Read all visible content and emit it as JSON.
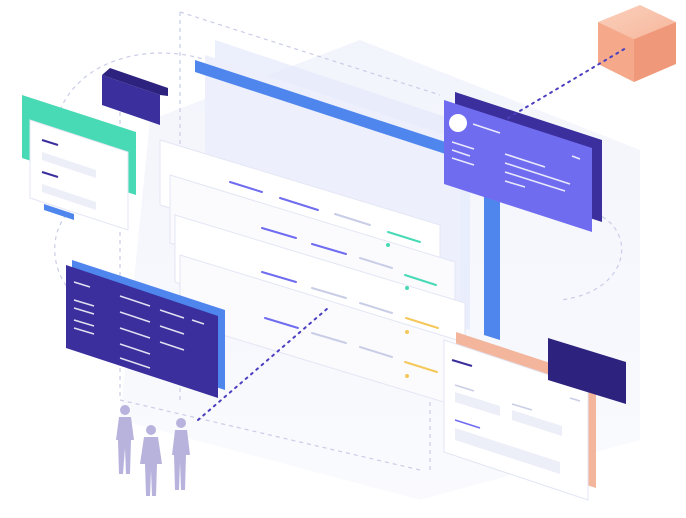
{
  "illustration": {
    "kind": "isometric dashboard illustration",
    "colors": {
      "indigo": "#3a2f9c",
      "indigo_dark": "#2d237f",
      "violet": "#6f6cf0",
      "blue": "#4f86ee",
      "mint": "#48d9b5",
      "peach": "#f3b59b",
      "cube": "#f5a98a",
      "figure": "#b8b3dd",
      "panel": "#f6f7fb",
      "line": "#c9cde6"
    },
    "icons": [
      "cube-icon",
      "avatar-icon",
      "people-icon"
    ]
  }
}
